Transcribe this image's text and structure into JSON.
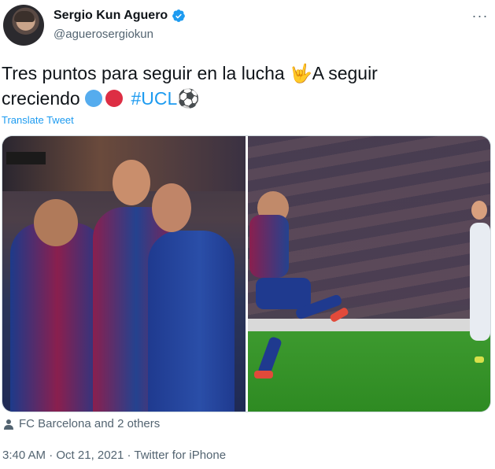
{
  "author": {
    "name": "Sergio Kun Aguero",
    "handle": "@aguerosergiokun"
  },
  "tweet": {
    "text_part1": "Tres puntos para seguir en la lucha ",
    "emoji_hand": "🤟",
    "text_part2": "A seguir",
    "text_part3": "creciendo ",
    "circle_colors": [
      "#55acee",
      "#dd2e44"
    ],
    "hashtag": "#UCL",
    "emoji_ball": "⚽"
  },
  "translate_label": "Translate Tweet",
  "tagged_label": "FC Barcelona and 2 others",
  "meta": {
    "time": "3:40 AM",
    "separator": " · ",
    "date": "Oct 21, 2021",
    "source": "Twitter for iPhone"
  },
  "colors": {
    "link": "#1d9bf0",
    "secondary_text": "#536471",
    "verified": "#1d9bf0"
  },
  "icons": [
    "verified-badge-icon",
    "more-options-icon",
    "person-icon"
  ]
}
